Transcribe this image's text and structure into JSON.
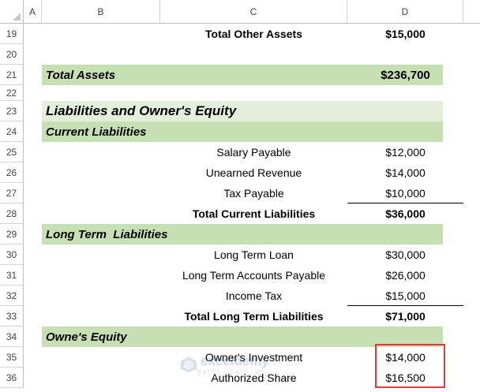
{
  "columns": [
    {
      "letter": "A"
    },
    {
      "letter": "B"
    },
    {
      "letter": "C"
    },
    {
      "letter": "D"
    }
  ],
  "rows": [
    {
      "num": "19",
      "c": "Total Other Assets",
      "d": "$15,000"
    },
    {
      "num": "20"
    },
    {
      "num": "21",
      "b": "Total Assets",
      "d": "$236,700"
    },
    {
      "num": "22"
    },
    {
      "num": "23",
      "b": "Liabilities and Owner's Equity"
    },
    {
      "num": "24",
      "b": "Current Liabilities"
    },
    {
      "num": "25",
      "c": "Salary Payable",
      "d": "$12,000"
    },
    {
      "num": "26",
      "c": "Unearned Revenue",
      "d": "$14,000"
    },
    {
      "num": "27",
      "c": "Tax Payable",
      "d": "$10,000"
    },
    {
      "num": "28",
      "c": "Total Current Liabilities",
      "d": "$36,000"
    },
    {
      "num": "29",
      "b": "Long Term  Liabilities"
    },
    {
      "num": "30",
      "c": "Long Term Loan",
      "d": "$30,000"
    },
    {
      "num": "31",
      "c": "Long Term Accounts Payable",
      "d": "$26,000"
    },
    {
      "num": "32",
      "c": "Income Tax",
      "d": "$15,000"
    },
    {
      "num": "33",
      "c": "Total Long Term Liabilities",
      "d": "$71,000"
    },
    {
      "num": "34",
      "b": "Owne's Equity"
    },
    {
      "num": "35",
      "c": "Owner's Investment",
      "d": "$14,000"
    },
    {
      "num": "36",
      "c": "Authorized Share",
      "d": "$16,500"
    }
  ],
  "watermark": {
    "brand": "exceldemy",
    "tagline": "EXCEL · DATA · BI"
  },
  "colors": {
    "green_band": "#c6e0b4",
    "light_band": "#e2efda",
    "highlight_border": "#e03a3a"
  }
}
